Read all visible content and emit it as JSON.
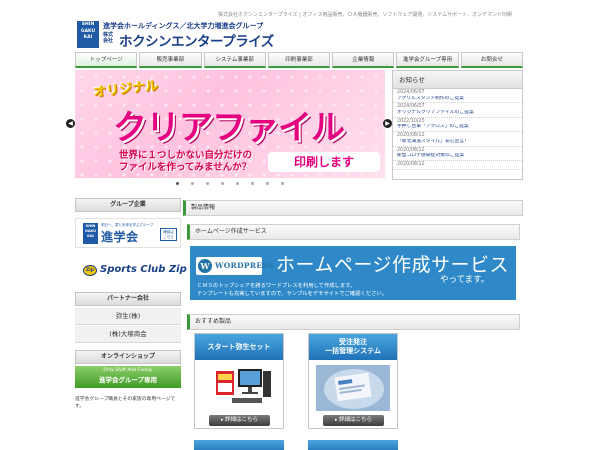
{
  "header": {
    "tagline": "株式会社ホクシンエンタープライズ | オフィス用品販売、ＯＡ機器販売、ソフトウェア開発、システムサポート、オンデマンド印刷",
    "logo_badge": "SHIN GAKU KAI",
    "logo_line1": "進学会ホールディングス／北大学力増進会グループ",
    "logo_corp": "株式会社",
    "logo_name": "ホクシンエンタープライズ"
  },
  "nav": {
    "items": [
      {
        "label": "トップページ"
      },
      {
        "label": "販売事業部"
      },
      {
        "label": "システム事業部"
      },
      {
        "label": "印刷事業部"
      },
      {
        "label": "企業情報"
      },
      {
        "label": "進学会グループ専用"
      },
      {
        "label": "お問合せ"
      }
    ]
  },
  "slider": {
    "orig": "オリジナル",
    "main": "クリアファイル",
    "sub_line1": "世界に１つしかない自分だけの",
    "sub_line2": "ファイルを作ってみませんか？",
    "badge": "印刷します"
  },
  "news": {
    "title": "お知らせ",
    "items": [
      {
        "date": "2024/06/07",
        "text": "アクリルスタンド制作のご提案"
      },
      {
        "date": "2024/06/07",
        "text": "オリジナルクリアファイルのご提案"
      },
      {
        "date": "2022/10/25",
        "text": "手押し台車「アクロス」のご提案"
      },
      {
        "date": "2020/08/12",
        "text": "「新北海道スタイル」安心宣言！"
      },
      {
        "date": "2020/08/12",
        "text": "新型コロナ感染症対策のご提案"
      },
      {
        "date": "2020/08/12",
        "text": ""
      }
    ]
  },
  "sidebar": {
    "group_title": "グループ企業",
    "shingaku_badge": "SHIN GAKU KAI",
    "shingaku_small": "明日へ、君と未来を学ぶグループ",
    "shingaku_name": "進学会",
    "shingaku_tag": "確認は こちら",
    "zip_logo": "Zip",
    "zip_text": "Sports Club Zip",
    "partner_title": "パートナー会社",
    "partners": [
      {
        "label": "弥生(株)"
      },
      {
        "label": "(株)大塚商会"
      }
    ],
    "shop_title": "オンラインショップ",
    "shop_small": "Only Staff And Family",
    "shop_big": "進学会グループ専用",
    "shop_caption": "進学会グループ職員とその家族の専用ページです。"
  },
  "main": {
    "product_title": "製品情報",
    "homepage_title": "ホームページ作成サービス",
    "wp": {
      "logo_icon": "W",
      "logo_text": "WORDPRESS",
      "title": "ホームページ作成サービス",
      "sub": "やってます。",
      "desc1": "ＣＭＳのトップシェアを誇るワードプレスを利用して作成します。",
      "desc2": "テンプレートも充実していますので、サンプルをデモサイトでご確認ください。"
    },
    "recommend_title": "おすすめ製品",
    "cards": [
      {
        "title": "スタート弥生セット",
        "button": "詳細はこちら"
      },
      {
        "title_line1": "受注発注",
        "title_line2": "一括管理システム",
        "button": "詳細はこちら"
      }
    ]
  }
}
